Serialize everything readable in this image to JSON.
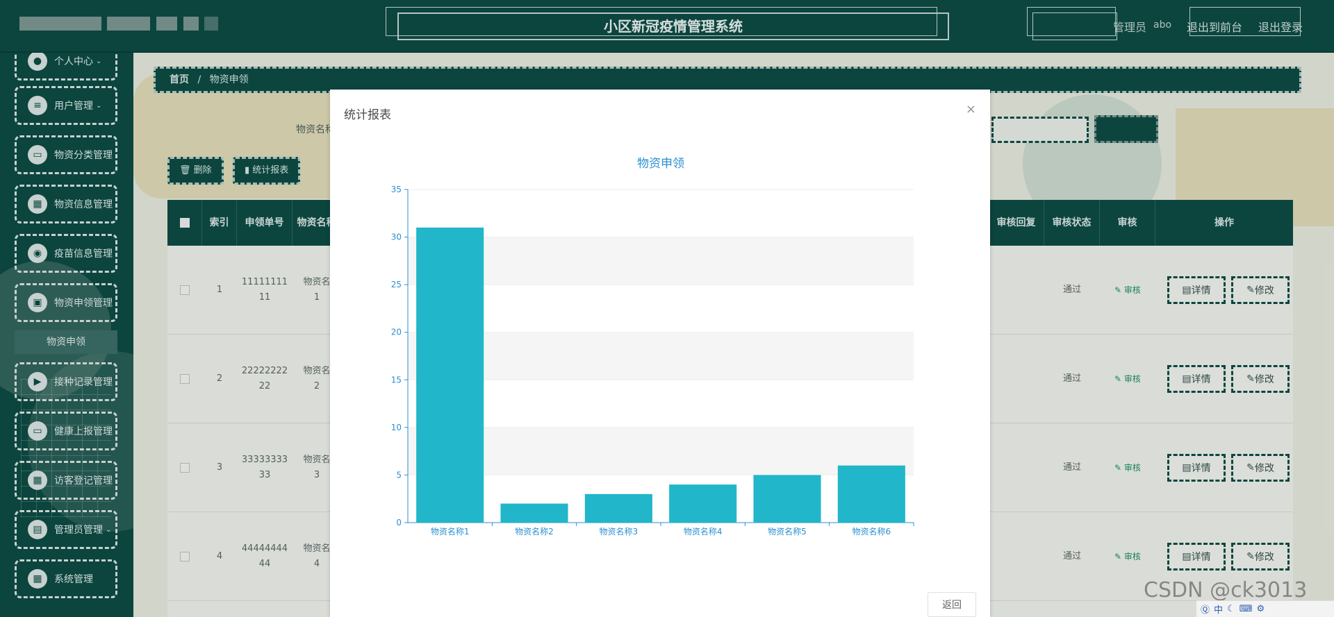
{
  "header": {
    "title": "小区新冠疫情管理系统",
    "role_label": "管理员",
    "username": "abo",
    "to_front_label": "退出到前台",
    "logout_label": "退出登录"
  },
  "sidebar": {
    "items": [
      {
        "label": "个人中心",
        "has_arrow": true,
        "icon": "user-icon"
      },
      {
        "label": "用户管理",
        "has_arrow": true,
        "icon": "list-icon"
      },
      {
        "label": "物资分类管理",
        "has_arrow": false,
        "icon": "folder-icon"
      },
      {
        "label": "物资信息管理",
        "has_arrow": false,
        "icon": "grid-icon"
      },
      {
        "label": "疫苗信息管理",
        "has_arrow": false,
        "icon": "pin-icon"
      },
      {
        "label": "物资申领管理",
        "has_arrow": false,
        "icon": "box-icon"
      },
      {
        "label": "接种记录管理",
        "has_arrow": false,
        "icon": "video-icon"
      },
      {
        "label": "健康上报管理",
        "has_arrow": false,
        "icon": "monitor-icon"
      },
      {
        "label": "访客登记管理",
        "has_arrow": false,
        "icon": "grid-icon"
      },
      {
        "label": "管理员管理",
        "has_arrow": true,
        "icon": "doc-icon"
      },
      {
        "label": "系统管理",
        "has_arrow": false,
        "icon": "grid-icon"
      }
    ],
    "submenu_label": "物资申领"
  },
  "breadcrumb": {
    "home": "首页",
    "separator": "/",
    "current": "物资申领"
  },
  "search": {
    "label": "物资名称"
  },
  "toolbar": {
    "delete_label": "删除",
    "report_label": "统计报表"
  },
  "table": {
    "columns_left": [
      "索引",
      "申领单号",
      "物资名称"
    ],
    "columns_right": [
      "审核回复",
      "审核状态",
      "审核",
      "操作"
    ],
    "rows": [
      {
        "index": "1",
        "order_no": "11111111\n11",
        "name": "物资名\n1",
        "status": "通过"
      },
      {
        "index": "2",
        "order_no": "22222222\n22",
        "name": "物资名\n2",
        "status": "通过"
      },
      {
        "index": "3",
        "order_no": "33333333\n33",
        "name": "物资名\n3",
        "status": "通过"
      },
      {
        "index": "4",
        "order_no": "44444444\n44",
        "name": "物资名\n4",
        "status": "通过"
      }
    ],
    "audit_label": "审核",
    "detail_label": "详情",
    "edit_label": "修改"
  },
  "dialog": {
    "title": "统计报表",
    "close_glyph": "×",
    "return_label": "返回"
  },
  "chart_data": {
    "type": "bar",
    "title": "物资申领",
    "categories": [
      "物资名称1",
      "物资名称2",
      "物资名称3",
      "物资名称4",
      "物资名称5",
      "物资名称6"
    ],
    "values": [
      31,
      2,
      3,
      4,
      5,
      6
    ],
    "ylim": [
      0,
      35
    ],
    "yticks": [
      0,
      5,
      10,
      15,
      20,
      25,
      30,
      35
    ],
    "bar_color": "#21b6c9",
    "axis_color": "#2c8fd1",
    "grid": "alternating-bands"
  },
  "watermark": "CSDN @ck3013",
  "taskbar": {
    "ime_label": "中"
  }
}
